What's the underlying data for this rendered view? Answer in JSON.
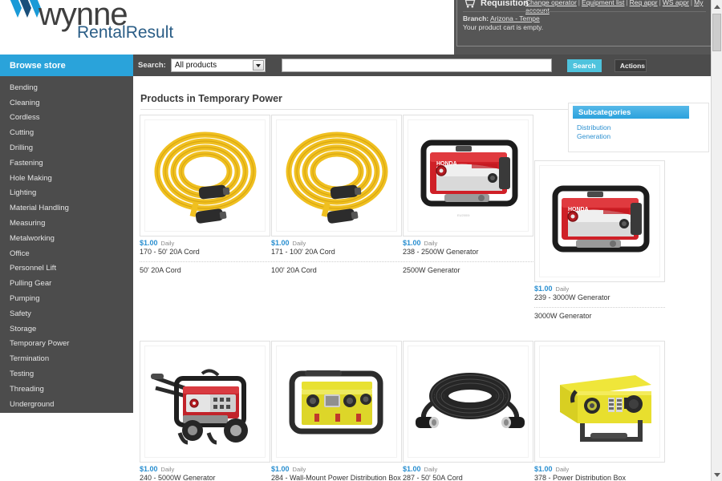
{
  "brand": {
    "logo_primary": "wynne",
    "logo_secondary": "RentalResult",
    "accent_blue": "#2aa3da",
    "dark_gray": "#4c4c4c",
    "link_blue": "#2a8fd0"
  },
  "header": {
    "top_links": [
      {
        "label": "Change operator"
      },
      {
        "label": "Equipment list"
      },
      {
        "label": "Req appr"
      },
      {
        "label": "WS appr"
      },
      {
        "label": "My account"
      }
    ],
    "separator": "|",
    "requisition_label": "Requisition",
    "cart_icon": "shopping-cart-icon",
    "branch_label": "Branch:",
    "branch_value": "Arizona - Tempe",
    "cart_status": "Your product cart is empty."
  },
  "nav": {
    "browse_store": "Browse store",
    "search_label": "Search:",
    "search_scope_selected": "All products",
    "search_scope_options": [
      "All products"
    ],
    "search_value": "",
    "search_placeholder": "",
    "search_button": "Search",
    "actions_button": "Actions",
    "dropdown_icon": "chevron-down-icon"
  },
  "sidebar": {
    "items": [
      {
        "label": "Bending"
      },
      {
        "label": "Cleaning"
      },
      {
        "label": "Cordless"
      },
      {
        "label": "Cutting"
      },
      {
        "label": "Drilling"
      },
      {
        "label": "Fastening"
      },
      {
        "label": "Hole Making"
      },
      {
        "label": "Lighting"
      },
      {
        "label": "Material Handling"
      },
      {
        "label": "Measuring"
      },
      {
        "label": "Metalworking"
      },
      {
        "label": "Office"
      },
      {
        "label": "Personnel Lift"
      },
      {
        "label": "Pulling Gear"
      },
      {
        "label": "Pumping"
      },
      {
        "label": "Safety"
      },
      {
        "label": "Storage"
      },
      {
        "label": "Temporary Power"
      },
      {
        "label": "Termination"
      },
      {
        "label": "Testing"
      },
      {
        "label": "Threading"
      },
      {
        "label": "Underground"
      }
    ]
  },
  "main": {
    "page_title": "Products in Temporary Power",
    "subcategories": {
      "header": "Subcategories",
      "links": [
        {
          "label": "Distribution"
        },
        {
          "label": "Generation"
        }
      ]
    },
    "products": [
      {
        "price": "$1.00",
        "rate_period": "Daily",
        "name": "170 - 50' 20A Cord",
        "description": "50' 20A Cord",
        "image": "yellow-coiled-extension-cord"
      },
      {
        "price": "$1.00",
        "rate_period": "Daily",
        "name": "171 - 100' 20A Cord",
        "description": "100' 20A Cord",
        "image": "yellow-coiled-extension-cord"
      },
      {
        "price": "$1.00",
        "rate_period": "Daily",
        "name": "238 - 2500W Generator",
        "description": "2500W Generator",
        "image": "red-honda-generator"
      },
      {
        "price": "$1.00",
        "rate_period": "Daily",
        "name": "239 - 3000W Generator",
        "description": "3000W Generator",
        "image": "red-honda-generator"
      },
      {
        "price": "$1.00",
        "rate_period": "Daily",
        "name": "240 - 5000W Generator",
        "description": "",
        "image": "red-wheeled-generator"
      },
      {
        "price": "$1.00",
        "rate_period": "Daily",
        "name": "284 - Wall-Mount Power Distribution Box",
        "description": "",
        "image": "yellow-distribution-box"
      },
      {
        "price": "$1.00",
        "rate_period": "Daily",
        "name": "287 - 50' 50A Cord",
        "description": "",
        "image": "black-coiled-cord"
      },
      {
        "price": "$1.00",
        "rate_period": "Daily",
        "name": "378 - Power Distribution Box",
        "description": "",
        "image": "yellow-spider-box"
      }
    ]
  },
  "scrollbar": {
    "up_icon": "chevron-up-icon",
    "down_icon": "chevron-down-icon"
  }
}
